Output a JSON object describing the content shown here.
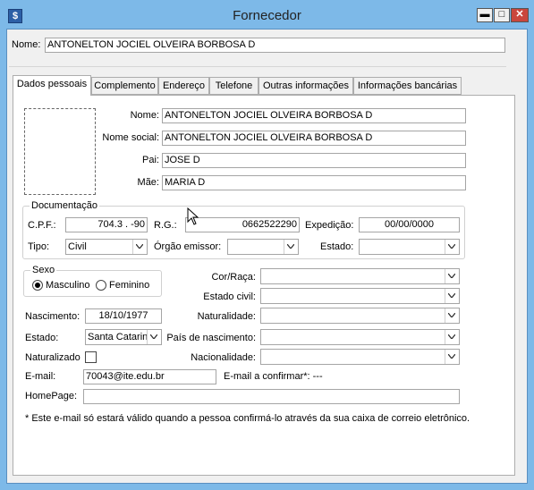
{
  "window": {
    "title": "Fornecedor"
  },
  "header": {
    "name_label": "Nome:",
    "name_value": "ANTONELTON JOCIEL OLVEIRA BORBOSA D"
  },
  "tabs": [
    "Dados pessoais",
    "Complemento",
    "Endereço",
    "Telefone",
    "Outras informações",
    "Informações bancárias"
  ],
  "personal": {
    "nome_label": "Nome:",
    "nome": "ANTONELTON JOCIEL OLVEIRA BORBOSA D",
    "nome_social_label": "Nome social:",
    "nome_social": "ANTONELTON JOCIEL OLVEIRA BORBOSA D",
    "pai_label": "Pai:",
    "pai": "JOSE D",
    "mae_label": "Mãe:",
    "mae": "MARIA D"
  },
  "documentacao": {
    "title": "Documentação",
    "cpf_label": "C.P.F.:",
    "cpf": "704.3  .  -90",
    "rg_label": "R.G.:",
    "rg": "0662522290",
    "expedicao_label": "Expedição:",
    "expedicao": "00/00/0000",
    "tipo_label": "Tipo:",
    "tipo": "Civil",
    "orgao_label": "Órgão emissor:",
    "orgao": "",
    "estado_label": "Estado:",
    "estado": ""
  },
  "sexo": {
    "title": "Sexo",
    "masculino": "Masculino",
    "feminino": "Feminino",
    "selected": "Masculino"
  },
  "details": {
    "cor_label": "Cor/Raça:",
    "cor": "",
    "estado_civil_label": "Estado civil:",
    "estado_civil": "",
    "nascimento_label": "Nascimento:",
    "nascimento": "18/10/1977",
    "naturalidade_label": "Naturalidade:",
    "naturalidade": "",
    "estado_label": "Estado:",
    "estado": "Santa Catarina",
    "pais_label": "País de nascimento:",
    "pais": "",
    "naturalizado_label": "Naturalizado",
    "nacionalidade_label": "Nacionalidade:",
    "nacionalidade": "",
    "email_label": "E-mail:",
    "email": "70043@ite.edu.br",
    "email_confirm_label": "E-mail a confirmar*: ---",
    "homepage_label": "HomePage:",
    "homepage": ""
  },
  "footnote": "* Este e-mail só estará válido quando a pessoa confirmá-lo através da sua caixa de correio eletrônico.",
  "icons": {
    "app": "app-icon",
    "minimize": "minimize-icon",
    "maximize": "maximize-icon",
    "close": "close-icon",
    "dropdown": "chevron-down-icon",
    "cursor": "mouse-cursor-icon"
  }
}
